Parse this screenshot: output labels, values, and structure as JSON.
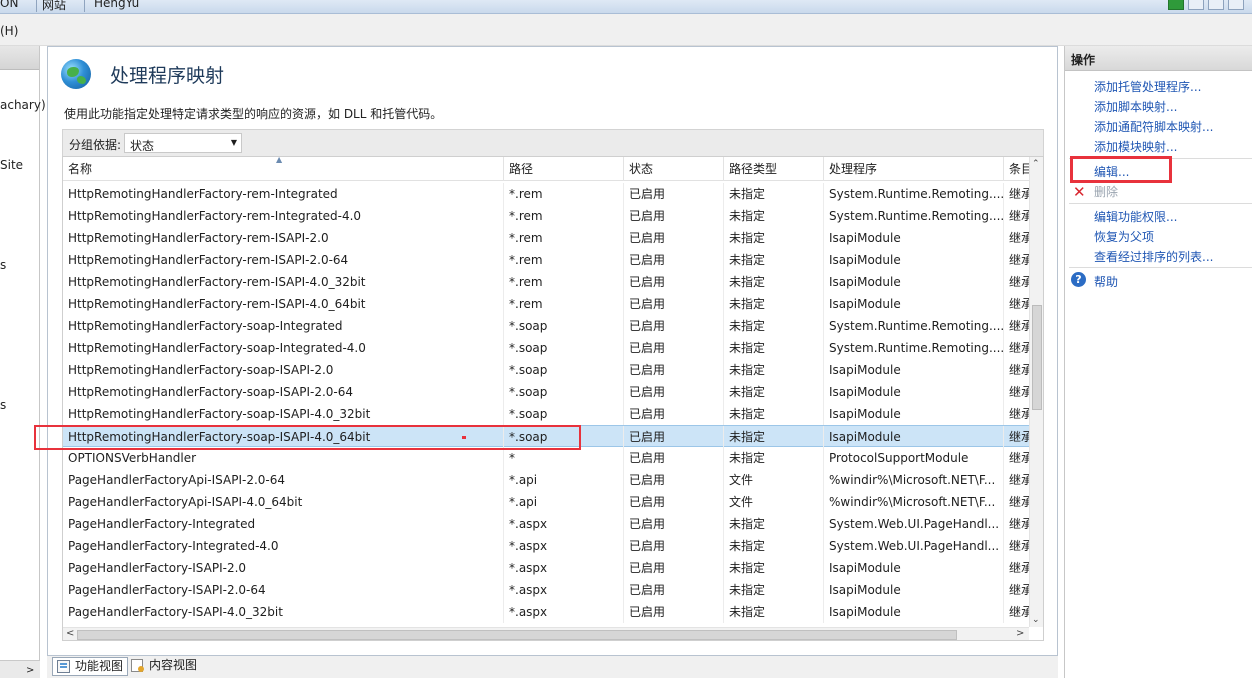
{
  "address_bar": {
    "crumbs": [
      "ON",
      "网站",
      "HengYu"
    ]
  },
  "menu": {
    "help_label": "(H)"
  },
  "left_pane": {
    "items": [
      "achary)",
      "Site",
      "s",
      "s"
    ]
  },
  "feature": {
    "title": "处理程序映射",
    "description": "使用此功能指定处理特定请求类型的响应的资源，如 DLL 和托管代码。",
    "group_label": "分组依据:",
    "group_value": "状态"
  },
  "table": {
    "columns": [
      "名称",
      "路径",
      "状态",
      "路径类型",
      "处理程序",
      "条目"
    ],
    "rows": [
      [
        "HttpRemotingHandlerFactory-rem-Integrated",
        "*.rem",
        "已启用",
        "未指定",
        "System.Runtime.Remoting....",
        "继承"
      ],
      [
        "HttpRemotingHandlerFactory-rem-Integrated-4.0",
        "*.rem",
        "已启用",
        "未指定",
        "System.Runtime.Remoting....",
        "继承"
      ],
      [
        "HttpRemotingHandlerFactory-rem-ISAPI-2.0",
        "*.rem",
        "已启用",
        "未指定",
        "IsapiModule",
        "继承"
      ],
      [
        "HttpRemotingHandlerFactory-rem-ISAPI-2.0-64",
        "*.rem",
        "已启用",
        "未指定",
        "IsapiModule",
        "继承"
      ],
      [
        "HttpRemotingHandlerFactory-rem-ISAPI-4.0_32bit",
        "*.rem",
        "已启用",
        "未指定",
        "IsapiModule",
        "继承"
      ],
      [
        "HttpRemotingHandlerFactory-rem-ISAPI-4.0_64bit",
        "*.rem",
        "已启用",
        "未指定",
        "IsapiModule",
        "继承"
      ],
      [
        "HttpRemotingHandlerFactory-soap-Integrated",
        "*.soap",
        "已启用",
        "未指定",
        "System.Runtime.Remoting....",
        "继承"
      ],
      [
        "HttpRemotingHandlerFactory-soap-Integrated-4.0",
        "*.soap",
        "已启用",
        "未指定",
        "System.Runtime.Remoting....",
        "继承"
      ],
      [
        "HttpRemotingHandlerFactory-soap-ISAPI-2.0",
        "*.soap",
        "已启用",
        "未指定",
        "IsapiModule",
        "继承"
      ],
      [
        "HttpRemotingHandlerFactory-soap-ISAPI-2.0-64",
        "*.soap",
        "已启用",
        "未指定",
        "IsapiModule",
        "继承"
      ],
      [
        "HttpRemotingHandlerFactory-soap-ISAPI-4.0_32bit",
        "*.soap",
        "已启用",
        "未指定",
        "IsapiModule",
        "继承"
      ],
      [
        "HttpRemotingHandlerFactory-soap-ISAPI-4.0_64bit",
        "*.soap",
        "已启用",
        "未指定",
        "IsapiModule",
        "继承"
      ],
      [
        "OPTIONSVerbHandler",
        "*",
        "已启用",
        "未指定",
        "ProtocolSupportModule",
        "继承"
      ],
      [
        "PageHandlerFactoryApi-ISAPI-2.0-64",
        "*.api",
        "已启用",
        "文件",
        "%windir%\\Microsoft.NET\\F...",
        "继承"
      ],
      [
        "PageHandlerFactoryApi-ISAPI-4.0_64bit",
        "*.api",
        "已启用",
        "文件",
        "%windir%\\Microsoft.NET\\F...",
        "继承"
      ],
      [
        "PageHandlerFactory-Integrated",
        "*.aspx",
        "已启用",
        "未指定",
        "System.Web.UI.PageHandl...",
        "继承"
      ],
      [
        "PageHandlerFactory-Integrated-4.0",
        "*.aspx",
        "已启用",
        "未指定",
        "System.Web.UI.PageHandl...",
        "继承"
      ],
      [
        "PageHandlerFactory-ISAPI-2.0",
        "*.aspx",
        "已启用",
        "未指定",
        "IsapiModule",
        "继承"
      ],
      [
        "PageHandlerFactory-ISAPI-2.0-64",
        "*.aspx",
        "已启用",
        "未指定",
        "IsapiModule",
        "继承"
      ],
      [
        "PageHandlerFactory-ISAPI-4.0_32bit",
        "*.aspx",
        "已启用",
        "未指定",
        "IsapiModule",
        "继承"
      ]
    ],
    "selected_row_index": 11
  },
  "actions": {
    "header": "操作",
    "add_managed": "添加托管处理程序...",
    "add_script": "添加脚本映射...",
    "add_wildcard": "添加通配符脚本映射...",
    "add_module": "添加模块映射...",
    "edit": "编辑...",
    "delete": "删除",
    "edit_permissions": "编辑功能权限...",
    "revert": "恢复为父项",
    "view_ordered": "查看经过排序的列表...",
    "help": "帮助"
  },
  "bottom_tabs": {
    "features_view": "功能视图",
    "content_view": "内容视图"
  },
  "colors": {
    "selection": "#cce4f7",
    "highlight_box": "#e8323c",
    "link": "#1f56b3"
  }
}
